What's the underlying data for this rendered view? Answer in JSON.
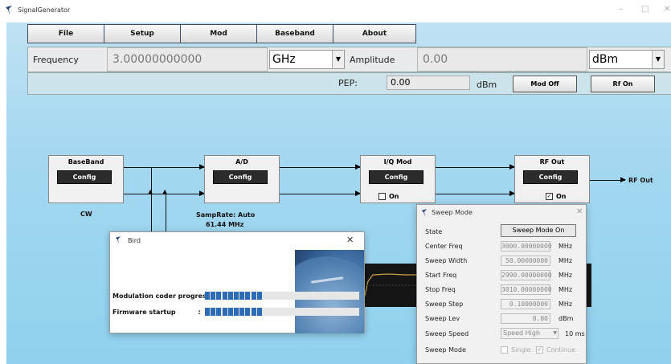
{
  "window": {
    "title": "SignalGenerator",
    "controls": [
      "–",
      "□",
      "✕"
    ]
  },
  "menu": [
    "File",
    "Setup",
    "Mod",
    "Baseband",
    "About"
  ],
  "frequency": {
    "label": "Frequency",
    "value": "3.00000000000",
    "unit": "GHz"
  },
  "amplitude": {
    "label": "Amplitude",
    "value": "0.00",
    "unit": "dBm"
  },
  "pep": {
    "label": "PEP:",
    "value": "0.00",
    "unit": "dBm"
  },
  "buttons": {
    "mod_off": "Mod Off",
    "rf_on": "Rf On"
  },
  "blocks": {
    "baseband": {
      "title": "BaseBand",
      "config": "Config",
      "sub": "CW"
    },
    "ad": {
      "title": "A/D",
      "config": "Config",
      "samprate": "SampRate: Auto",
      "freq": "61.44 MHz"
    },
    "iq": {
      "title": "I/Q Mod",
      "config": "Config",
      "on_label": "On",
      "on_checked": false
    },
    "rf": {
      "title": "RF Out",
      "config": "Config",
      "on_label": "On",
      "on_checked": true,
      "out_label": "RF Out"
    }
  },
  "bird": {
    "title": "Bird",
    "rows": [
      {
        "label": "Modulation coder progress:",
        "segments": 10
      },
      {
        "label": "Firmware startup          :",
        "segments": 10
      }
    ]
  },
  "sweep": {
    "title": "Sweep Mode",
    "state_label": "State",
    "state_button": "Sweep Mode On",
    "rows": [
      {
        "label": "Center Freq",
        "value": "3000.00000000",
        "unit": "MHz"
      },
      {
        "label": "Sweep Width",
        "value": "50.00000000",
        "unit": "MHz"
      },
      {
        "label": "Start Freq",
        "value": "2990.00000000",
        "unit": "MHz"
      },
      {
        "label": "Stop Freq",
        "value": "3010.00000000",
        "unit": "MHz"
      },
      {
        "label": "Sweep Step",
        "value": "0.10000000",
        "unit": "MHz"
      },
      {
        "label": "Sweep Lev",
        "value": "0.00",
        "unit": "dBm"
      }
    ],
    "speed": {
      "label": "Sweep Speed",
      "value": "Speed High",
      "time": "10 ms"
    },
    "mode": {
      "label": "Sweep Mode",
      "single": "Single",
      "continue": "Continue"
    }
  }
}
